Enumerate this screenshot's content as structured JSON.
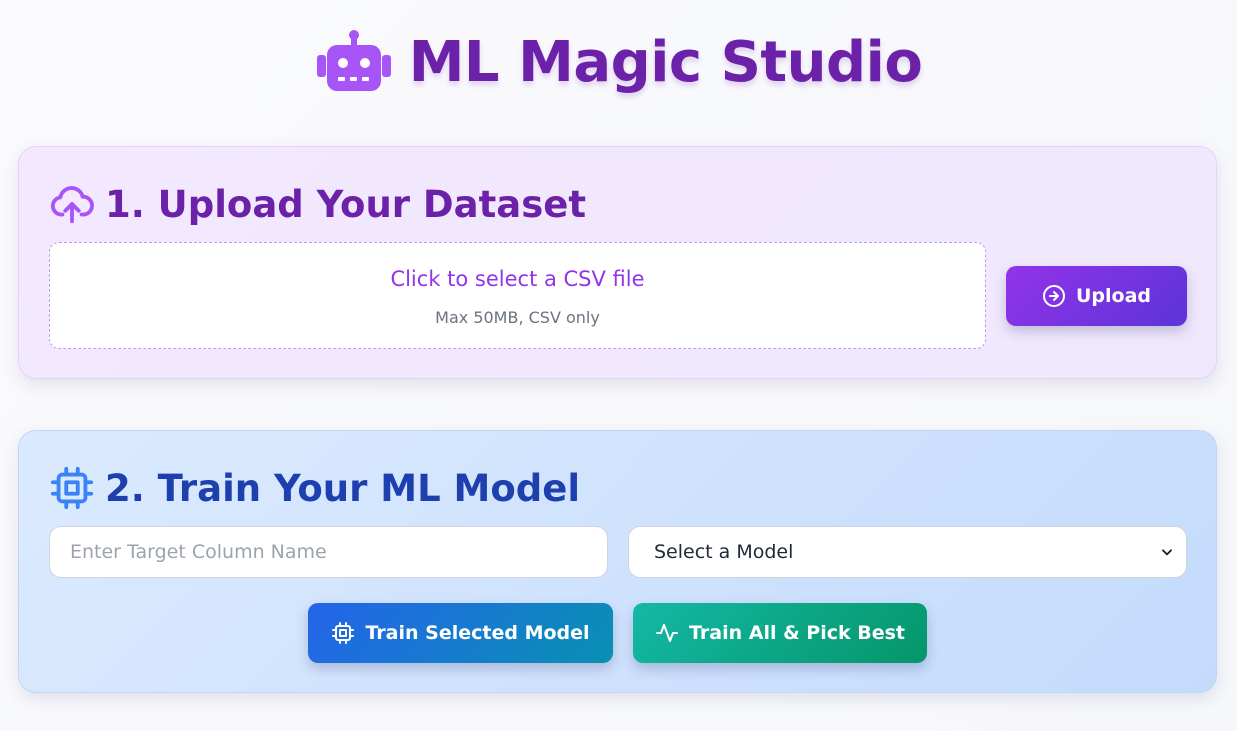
{
  "app": {
    "title": "ML Magic Studio",
    "logo_icon": "robot-icon"
  },
  "upload_section": {
    "title": "1. Upload Your Dataset",
    "icon": "cloud-upload-icon",
    "dropzone": {
      "label": "Click to select a CSV file",
      "hint": "Max 50MB, CSV only"
    },
    "upload_button": "Upload",
    "upload_button_icon": "arrow-right-circle-icon"
  },
  "train_section": {
    "title": "2. Train Your ML Model",
    "icon": "cpu-chip-icon",
    "target_input": {
      "value": "",
      "placeholder": "Enter Target Column Name"
    },
    "model_select": {
      "selected": "Select a Model"
    },
    "train_selected_button": "Train Selected Model",
    "train_selected_icon": "cpu-chip-icon",
    "train_all_button": "Train All & Pick Best",
    "train_all_icon": "activity-pulse-icon"
  },
  "colors": {
    "brand_purple": "#6b21a8",
    "accent_violet": "#9333ea",
    "train_blue": "#1e40af",
    "train_green": "#059669"
  }
}
